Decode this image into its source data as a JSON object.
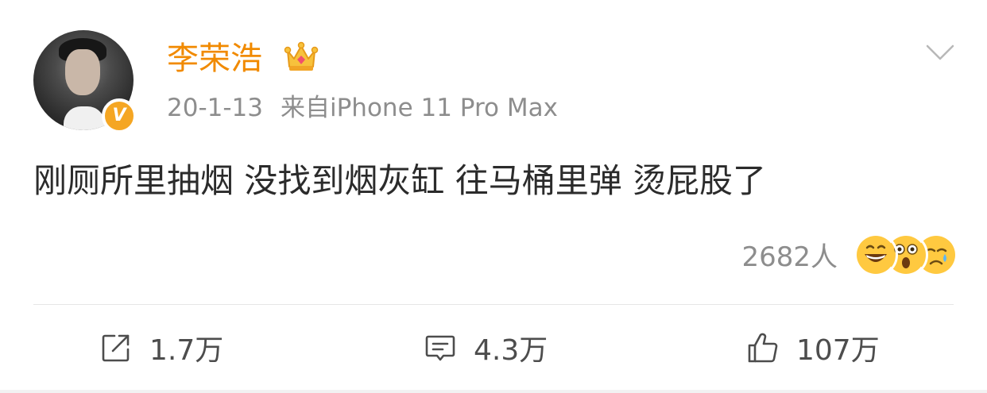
{
  "post": {
    "author": {
      "name": "李荣浩",
      "verified_badge": "V",
      "badge_color": "#f5a623",
      "name_color": "#f18a00",
      "avatar_icon": "avatar-portrait",
      "crown_icon": "crown-icon"
    },
    "date": "20-1-13",
    "source": "来自iPhone 11 Pro Max",
    "text": "刚厕所里抽烟 没找到烟灰缸 往马桶里弹 烫屁股了",
    "reactions": {
      "count": "2682人",
      "emojis": [
        "grinning-face-icon",
        "astonished-face-icon",
        "crying-face-icon"
      ]
    },
    "actions": {
      "repost": "1.7万",
      "comment": "4.3万",
      "like": "107万"
    }
  }
}
